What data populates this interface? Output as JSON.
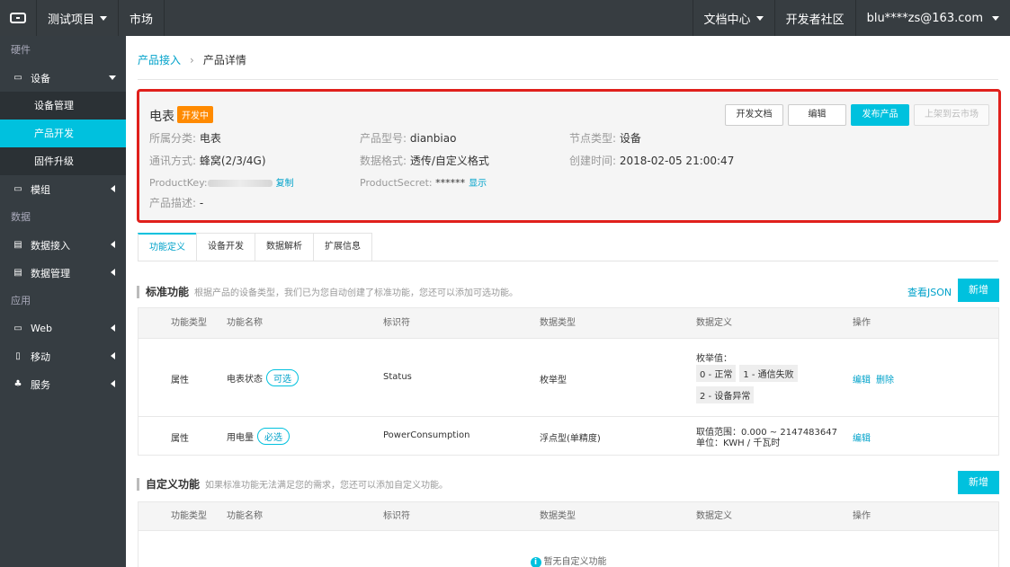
{
  "topbar": {
    "project": "测试项目",
    "market": "市场",
    "docs": "文档中心",
    "community": "开发者社区",
    "user": "blu****zs@163.com"
  },
  "sidebar": {
    "group_hardware": "硬件",
    "device": "设备",
    "device_manage": "设备管理",
    "product_dev": "产品开发",
    "firmware": "固件升级",
    "module": "模组",
    "group_data": "数据",
    "data_access": "数据接入",
    "data_manage": "数据管理",
    "group_app": "应用",
    "web": "Web",
    "mobile": "移动",
    "service": "服务"
  },
  "breadcrumb": {
    "parent": "产品接入",
    "current": "产品详情"
  },
  "product": {
    "name": "电表",
    "status": "开发中",
    "btn_docs": "开发文档",
    "btn_edit": "编辑",
    "btn_publish": "发布产品",
    "btn_market": "上架到云市场",
    "category_label": "所属分类:",
    "category": "电表",
    "model_label": "产品型号:",
    "model": "dianbiao",
    "node_label": "节点类型:",
    "node": "设备",
    "comm_label": "通讯方式:",
    "comm": "蜂窝(2/3/4G)",
    "format_label": "数据格式:",
    "format": "透传/自定义格式",
    "created_label": "创建时间:",
    "created": "2018-02-05 21:00:47",
    "key_label": "ProductKey:",
    "copy": "复制",
    "secret_label": "ProductSecret:",
    "secret": "******",
    "show": "显示",
    "desc_label": "产品描述:",
    "desc": "-"
  },
  "tabs": [
    "功能定义",
    "设备开发",
    "数据解析",
    "扩展信息"
  ],
  "standard": {
    "title": "标准功能",
    "desc": "根据产品的设备类型，我们已为您自动创建了标准功能，您还可以添加可选功能。",
    "json_link": "查看JSON",
    "add": "新增"
  },
  "columns": [
    "功能类型",
    "功能名称",
    "标识符",
    "数据类型",
    "数据定义",
    "操作"
  ],
  "rows": [
    {
      "type": "属性",
      "name": "电表状态",
      "tag": "可选",
      "id": "Status",
      "dtype": "枚举型",
      "def_title": "枚举值：",
      "def_items": [
        "0 - 正常",
        "1 - 通信失败",
        "2 - 设备异常"
      ],
      "op_edit": "编辑",
      "op_delete": "删除"
    },
    {
      "type": "属性",
      "name": "用电量",
      "tag": "必选",
      "id": "PowerConsumption",
      "dtype": "浮点型(单精度)",
      "def_range": "取值范围：0.000 ~ 2147483647",
      "def_unit": "单位：KWH / 千瓦时",
      "op_edit": "编辑"
    }
  ],
  "custom": {
    "title": "自定义功能",
    "desc": "如果标准功能无法满足您的需求，您还可以添加自定义功能。",
    "add": "新增",
    "empty": "暂无自定义功能"
  }
}
